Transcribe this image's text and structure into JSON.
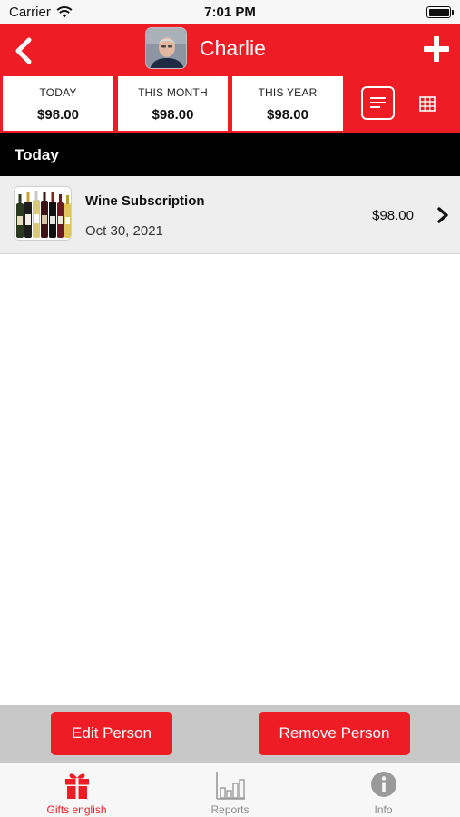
{
  "status_bar": {
    "carrier": "Carrier",
    "time": "7:01 PM"
  },
  "header": {
    "person_name": "Charlie",
    "back_icon": "chevron-left-icon",
    "add_icon": "plus-icon",
    "background_color": "#ee1c25"
  },
  "summary": {
    "today_label": "TODAY",
    "today_value": "$98.00",
    "month_label": "THIS MONTH",
    "month_value": "$98.00",
    "year_label": "THIS YEAR",
    "year_value": "$98.00",
    "list_view_icon": "list-view-icon",
    "grid_view_icon": "grid-view-icon"
  },
  "section": {
    "title": "Today"
  },
  "gifts": [
    {
      "name": "Wine Subscription",
      "date": "Oct 30, 2021",
      "price": "$98.00",
      "icon": "wine-bottles-thumbnail"
    }
  ],
  "actions": {
    "edit_label": "Edit Person",
    "remove_label": "Remove Person"
  },
  "tab_bar": {
    "tabs": [
      {
        "label": "Gifts english",
        "icon": "gift-icon",
        "active": true
      },
      {
        "label": "Reports",
        "icon": "bar-chart-icon",
        "active": false
      },
      {
        "label": "Info",
        "icon": "info-icon",
        "active": false
      }
    ]
  },
  "colors": {
    "accent": "#ee1c25",
    "section_header": "#000000",
    "row_background": "#eeeeee",
    "action_bar": "#c8c8c8"
  }
}
